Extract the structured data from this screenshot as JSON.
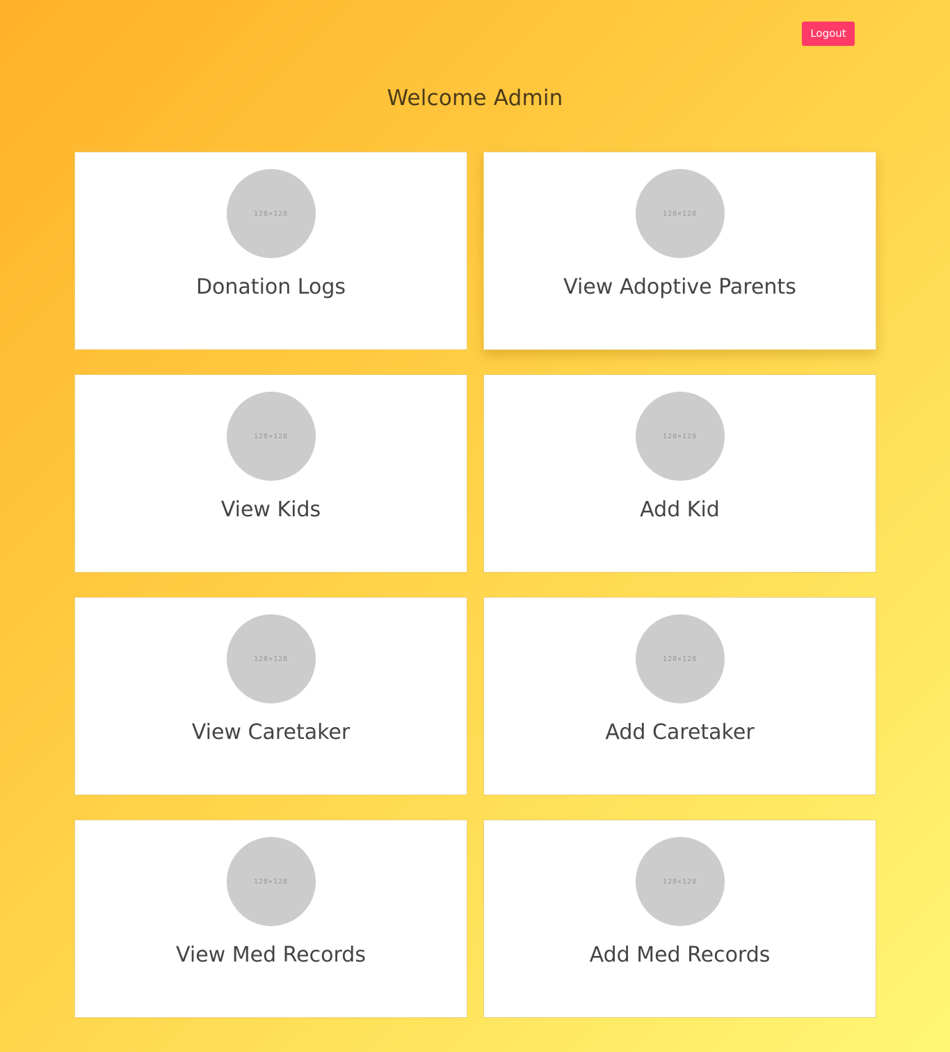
{
  "header": {
    "logout_label": "Logout",
    "title": "Welcome Admin"
  },
  "colors": {
    "logout_button": "#ff3a66",
    "card_background": "#ffffff",
    "thumbnail_placeholder": "#cccccc"
  },
  "cards": [
    {
      "label": "Donation Logs",
      "thumbnail": "128×128"
    },
    {
      "label": "View Adoptive Parents",
      "thumbnail": "128×128"
    },
    {
      "label": "View Kids",
      "thumbnail": "128×128"
    },
    {
      "label": "Add Kid",
      "thumbnail": "128×128"
    },
    {
      "label": "View Caretaker",
      "thumbnail": "128×128"
    },
    {
      "label": "Add Caretaker",
      "thumbnail": "128×128"
    },
    {
      "label": "View Med Records",
      "thumbnail": "128×128"
    },
    {
      "label": "Add Med Records",
      "thumbnail": "128×128"
    }
  ]
}
